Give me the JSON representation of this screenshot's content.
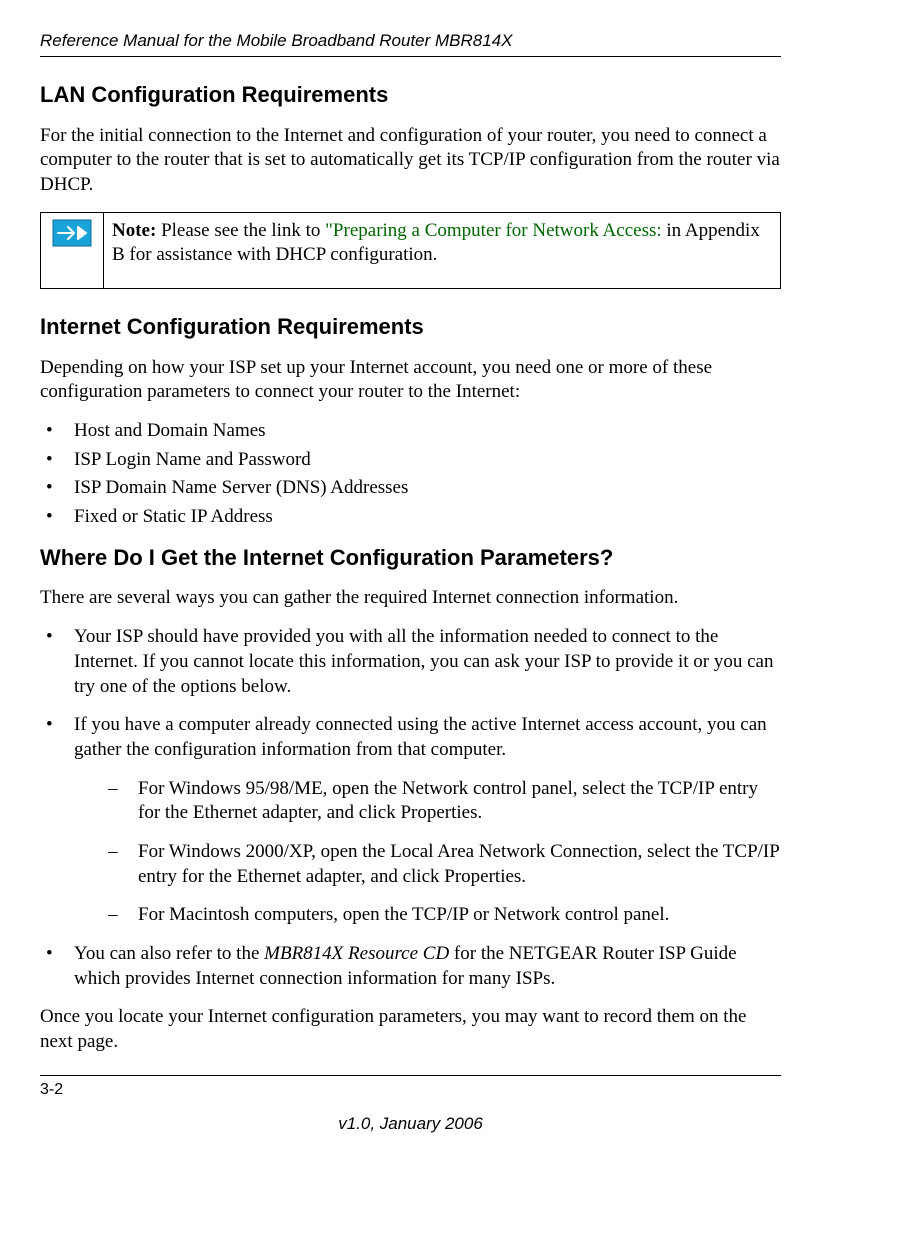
{
  "header": {
    "title": "Reference Manual for the Mobile Broadband Router MBR814X"
  },
  "sections": {
    "lan": {
      "heading": "LAN Configuration Requirements",
      "para": "For the initial connection to the Internet and configuration of your router, you need to connect a computer to the router that is set to automatically get its TCP/IP configuration from the router via DHCP."
    },
    "note": {
      "bold": "Note:",
      "pre_link": " Please see the link to ",
      "link": "\"Preparing a Computer for Network Access:",
      "post_link": " in Appendix B for assistance with DHCP configuration."
    },
    "internet": {
      "heading": "Internet Configuration Requirements",
      "para": "Depending on how your ISP set up your Internet account, you need one or more of these configuration parameters to connect your router to the Internet:",
      "items": [
        "Host and Domain Names",
        "ISP Login Name and Password",
        "ISP Domain Name Server (DNS) Addresses",
        "Fixed or Static IP Address"
      ]
    },
    "params": {
      "heading": "Where Do I Get the Internet Configuration Parameters?",
      "intro": "There are several ways you can gather the required Internet connection information.",
      "b1": "Your ISP should have provided you with all the information needed to connect to the Internet. If you cannot locate this information, you can ask your ISP to provide it or you can try one of the options below.",
      "b2": "If you have a computer already connected using the active Internet access account, you can gather the configuration information from that computer.",
      "s1": "For Windows 95/98/ME, open the Network control panel, select the TCP/IP entry for the Ethernet adapter, and click Properties.",
      "s2": "For Windows 2000/XP, open the Local Area Network Connection, select the TCP/IP entry for the Ethernet adapter, and click Properties.",
      "s3": "For Macintosh computers, open the TCP/IP or Network control panel.",
      "b3_pre": "You can also refer to the ",
      "b3_em": "MBR814X Resource CD",
      "b3_post": " for the NETGEAR Router ISP Guide which provides Internet connection information for many ISPs.",
      "outro": "Once you locate your Internet configuration parameters, you may want to record them on the next page."
    }
  },
  "footer": {
    "page": "3-2",
    "version": "v1.0, January 2006"
  }
}
